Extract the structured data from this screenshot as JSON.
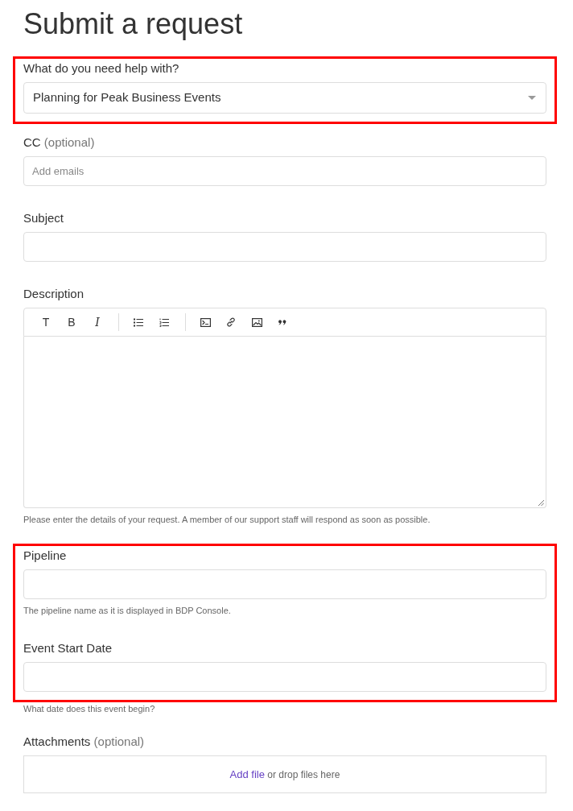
{
  "title": "Submit a request",
  "groups": [
    {
      "highlighted": true,
      "fields": [
        {
          "kind": "select",
          "label": "What do you need help with?",
          "value": "Planning for Peak Business Events"
        }
      ]
    },
    {
      "highlighted": false,
      "fields": [
        {
          "kind": "input",
          "label": "CC",
          "note": "(optional)",
          "placeholder": "Add emails"
        },
        {
          "kind": "input",
          "label": "Subject"
        },
        {
          "kind": "editor",
          "label": "Description",
          "toolbar": [
            {
              "label": "T",
              "italic": false
            },
            {
              "label": "B",
              "italic": false
            },
            {
              "label": "I",
              "italic": true
            }
          ],
          "hint": "Please enter the details of your request. A member of our support staff will respond as soon as possible."
        }
      ]
    },
    {
      "highlighted": true,
      "fields": [
        {
          "kind": "input",
          "label": "Pipeline",
          "hint": "The pipeline name as it is displayed in BDP Console."
        },
        {
          "kind": "input",
          "label": "Event Start Date",
          "hint": "What date does this event begin?"
        }
      ]
    },
    {
      "highlighted": false,
      "fields": [
        {
          "kind": "attachments",
          "label": "Attachments",
          "note": "(optional)",
          "link": "Add file",
          "text": "or drop files here"
        }
      ]
    }
  ]
}
